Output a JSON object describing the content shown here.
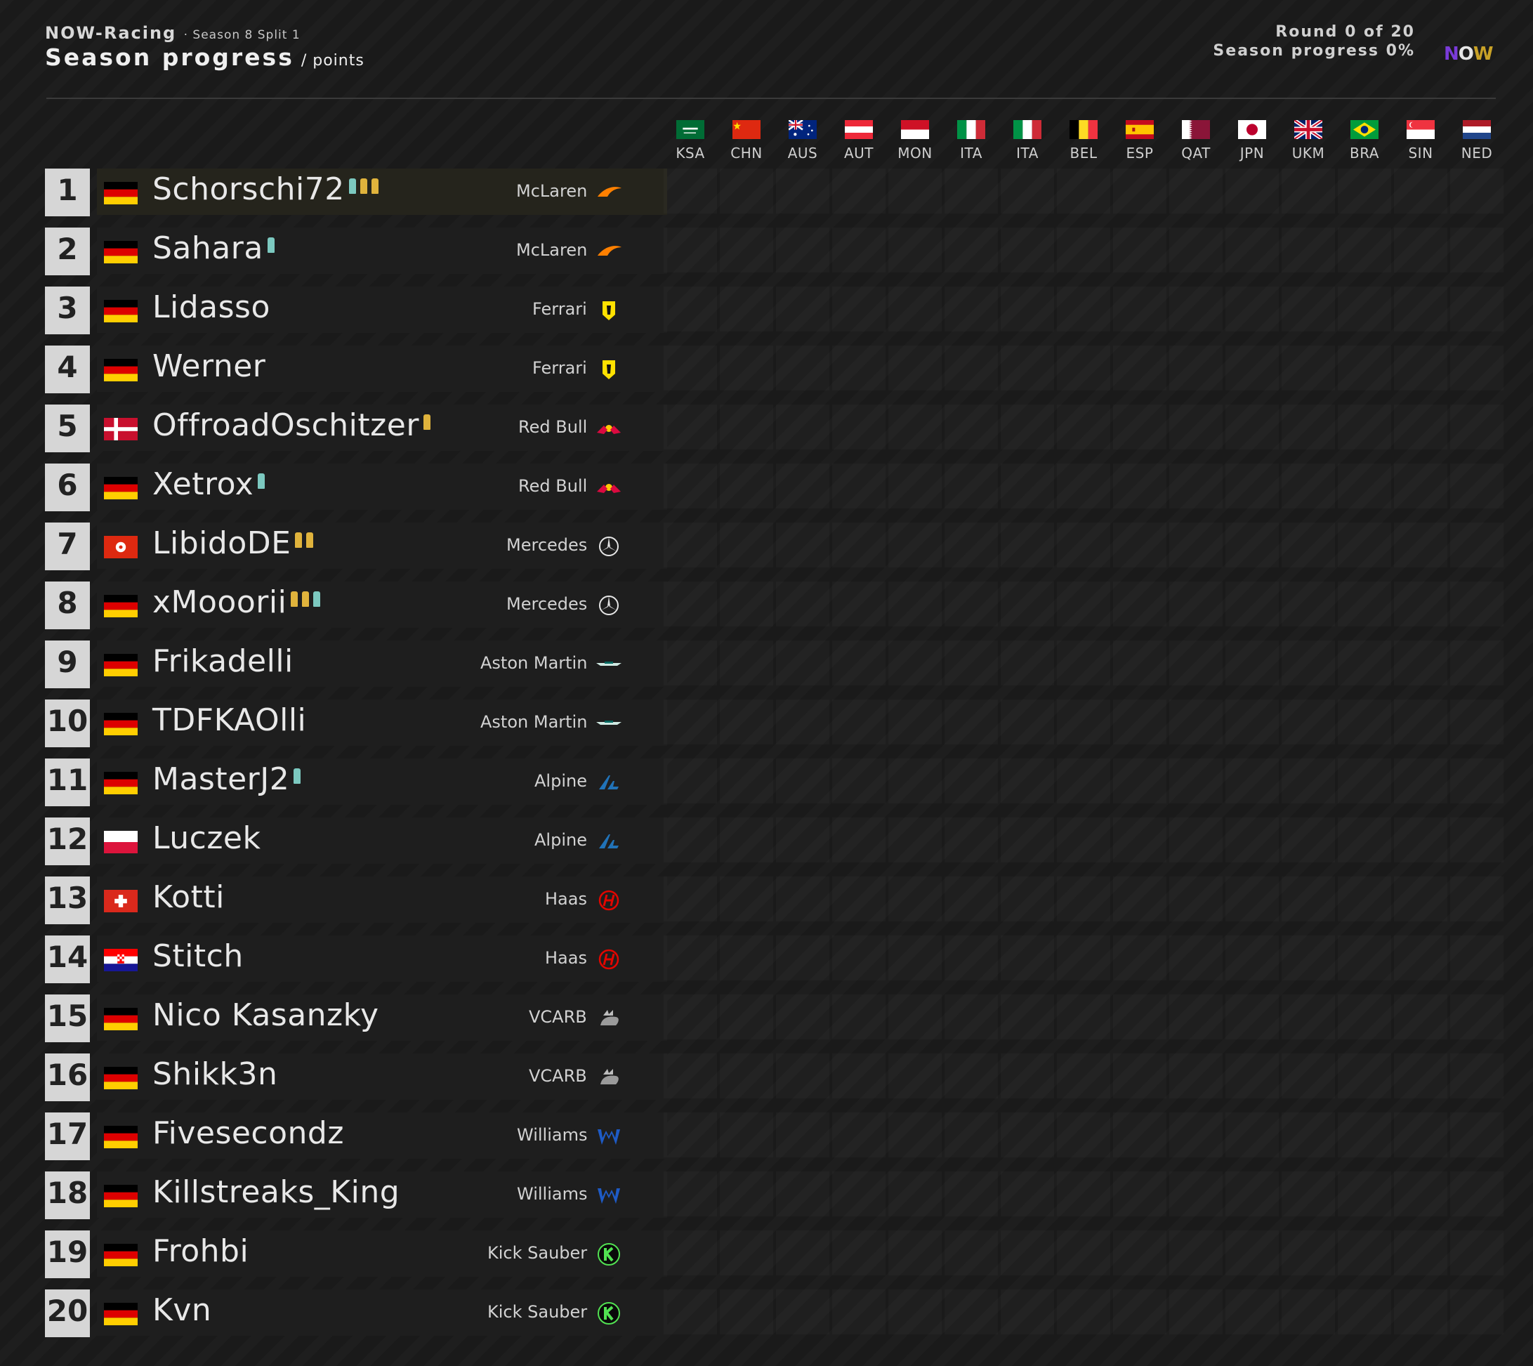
{
  "header": {
    "brand": "NOW-Racing",
    "season": "· Season 8 Split 1",
    "title": "Season progress",
    "subtitle": "/ points",
    "round": "Round 0 of 20",
    "progress": "Season progress 0%",
    "logo": {
      "n": "N",
      "o": "O",
      "w": "W"
    }
  },
  "races": [
    {
      "code": "KSA",
      "flag": "sa"
    },
    {
      "code": "CHN",
      "flag": "cn"
    },
    {
      "code": "AUS",
      "flag": "au"
    },
    {
      "code": "AUT",
      "flag": "at"
    },
    {
      "code": "MON",
      "flag": "mc"
    },
    {
      "code": "ITA",
      "flag": "it"
    },
    {
      "code": "ITA",
      "flag": "it"
    },
    {
      "code": "BEL",
      "flag": "be"
    },
    {
      "code": "ESP",
      "flag": "es"
    },
    {
      "code": "QAT",
      "flag": "qa"
    },
    {
      "code": "JPN",
      "flag": "jp"
    },
    {
      "code": "UKM",
      "flag": "gb"
    },
    {
      "code": "BRA",
      "flag": "br"
    },
    {
      "code": "SIN",
      "flag": "sg"
    },
    {
      "code": "NED",
      "flag": "nl"
    }
  ],
  "standings": [
    {
      "pos": "1",
      "flag": "de",
      "name": "Schorschi72",
      "trophies": [
        "teal",
        "gold",
        "gold"
      ],
      "team": "McLaren",
      "team_logo": "mclaren"
    },
    {
      "pos": "2",
      "flag": "de",
      "name": "Sahara",
      "trophies": [
        "teal"
      ],
      "team": "McLaren",
      "team_logo": "mclaren"
    },
    {
      "pos": "3",
      "flag": "de",
      "name": "Lidasso",
      "trophies": [],
      "team": "Ferrari",
      "team_logo": "ferrari"
    },
    {
      "pos": "4",
      "flag": "de",
      "name": "Werner",
      "trophies": [],
      "team": "Ferrari",
      "team_logo": "ferrari"
    },
    {
      "pos": "5",
      "flag": "dk",
      "name": "OffroadOschitzer",
      "trophies": [
        "gold"
      ],
      "team": "Red Bull",
      "team_logo": "redbull"
    },
    {
      "pos": "6",
      "flag": "de",
      "name": "Xetrox",
      "trophies": [
        "teal"
      ],
      "team": "Red Bull",
      "team_logo": "redbull"
    },
    {
      "pos": "7",
      "flag": "hk",
      "name": "LibidoDE",
      "trophies": [
        "gold",
        "gold"
      ],
      "team": "Mercedes",
      "team_logo": "mercedes"
    },
    {
      "pos": "8",
      "flag": "de",
      "name": "xMooorii",
      "trophies": [
        "gold",
        "gold",
        "teal"
      ],
      "team": "Mercedes",
      "team_logo": "mercedes"
    },
    {
      "pos": "9",
      "flag": "de",
      "name": "Frikadelli",
      "trophies": [],
      "team": "Aston Martin",
      "team_logo": "aston"
    },
    {
      "pos": "10",
      "flag": "de",
      "name": "TDFKAOlli",
      "trophies": [],
      "team": "Aston Martin",
      "team_logo": "aston"
    },
    {
      "pos": "11",
      "flag": "de",
      "name": "MasterJ2",
      "trophies": [
        "teal"
      ],
      "team": "Alpine",
      "team_logo": "alpine"
    },
    {
      "pos": "12",
      "flag": "pl",
      "name": "Luczek",
      "trophies": [],
      "team": "Alpine",
      "team_logo": "alpine"
    },
    {
      "pos": "13",
      "flag": "ch",
      "name": "Kotti",
      "trophies": [],
      "team": "Haas",
      "team_logo": "haas"
    },
    {
      "pos": "14",
      "flag": "hr",
      "name": "Stitch",
      "trophies": [],
      "team": "Haas",
      "team_logo": "haas"
    },
    {
      "pos": "15",
      "flag": "de",
      "name": "Nico Kasanzky",
      "trophies": [],
      "team": "VCARB",
      "team_logo": "vcarb"
    },
    {
      "pos": "16",
      "flag": "de",
      "name": "Shikk3n",
      "trophies": [],
      "team": "VCARB",
      "team_logo": "vcarb"
    },
    {
      "pos": "17",
      "flag": "de",
      "name": "Fivesecondz",
      "trophies": [],
      "team": "Williams",
      "team_logo": "williams"
    },
    {
      "pos": "18",
      "flag": "de",
      "name": "Killstreaks_King",
      "trophies": [],
      "team": "Williams",
      "team_logo": "williams"
    },
    {
      "pos": "19",
      "flag": "de",
      "name": "Frohbi",
      "trophies": [],
      "team": "Kick Sauber",
      "team_logo": "sauber"
    },
    {
      "pos": "20",
      "flag": "de",
      "name": "Kvn",
      "trophies": [],
      "team": "Kick Sauber",
      "team_logo": "sauber"
    }
  ],
  "colors": {
    "gold_trophy": "#e0b33c",
    "teal_trophy": "#7cc9c0",
    "leader_row": "#25241c",
    "position_box": "#d6d6d6"
  }
}
